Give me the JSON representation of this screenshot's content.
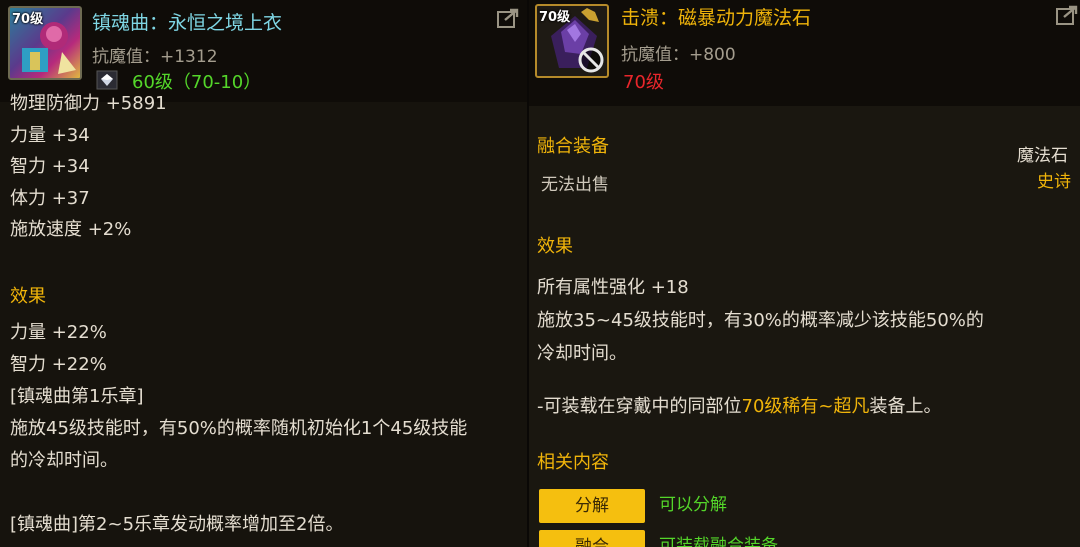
{
  "left": {
    "level_tag": "70级",
    "item_name": "镇魂曲：永恒之境上衣",
    "magic_resist": "抗魔值：+1312",
    "level_req": "60级（70-10）",
    "stats": [
      "物理防御力 +5891",
      "力量 +34",
      "智力 +34",
      "体力 +37",
      "施放速度 +2%"
    ],
    "effect_title": "效果",
    "effects": [
      "力量 +22%",
      "智力 +22%",
      "[镇魂曲第1乐章]",
      "施放45级技能时，有50%的概率随机初始化1个45级技能",
      "的冷却时间。",
      "",
      "[镇魂曲]第2~5乐章发动概率增加至2倍。"
    ]
  },
  "right": {
    "level_tag": "70级",
    "item_name": "击溃：磁暴动力魔法石",
    "magic_resist": "抗魔值：+800",
    "level_req": "70级",
    "item_type": "魔法石",
    "rarity": "史诗",
    "fusion_title": "融合装备",
    "unsellable": "无法出售",
    "effect_title": "效果",
    "effects": [
      "所有属性强化 +18",
      "施放35~45级技能时，有30%的概率减少该技能50%的",
      "冷却时间。"
    ],
    "note_prefix": "-可装载在穿戴中的同部位",
    "note_highlight": "70级稀有~超凡",
    "note_suffix": "装备上。",
    "related_title": "相关内容",
    "buttons": [
      {
        "label": "分解",
        "desc": "可以分解"
      },
      {
        "label": "融合",
        "desc": "可装载融合装备"
      }
    ]
  },
  "colors": {
    "title_cyan": "#7fd6e4",
    "title_gold": "#f0b40a",
    "section_gold": "#f0b40a",
    "req_green": "#54d62a",
    "req_red": "#e8262b",
    "button_yellow": "#f5bf0f"
  },
  "icons": [
    "armor-item-icon",
    "magic-stone-item-icon",
    "share-icon",
    "gem-icon",
    "no-trade-icon"
  ]
}
